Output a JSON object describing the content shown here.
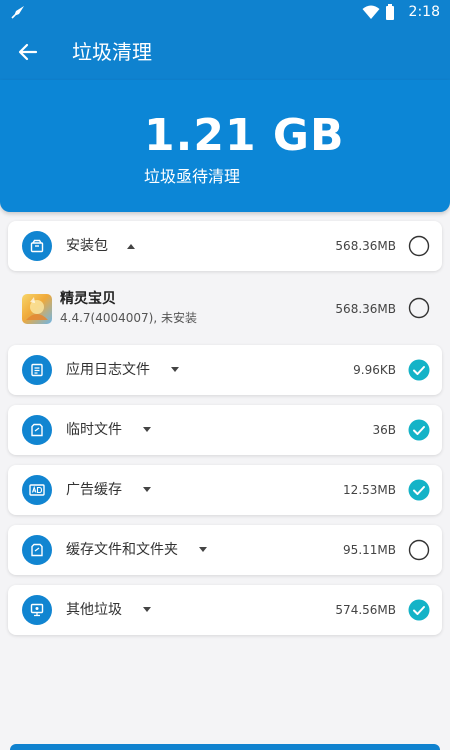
{
  "status_bar": {
    "time": "2:18",
    "icons": [
      "rocket-icon",
      "wifi-icon",
      "battery-icon"
    ]
  },
  "app_bar": {
    "title": "垃圾清理",
    "back_icon": "back-arrow-icon"
  },
  "summary": {
    "size": "1.21 GB",
    "subtitle": "垃圾亟待清理"
  },
  "categories": [
    {
      "label": "安装包",
      "amount": "568.36MB",
      "checked": false,
      "icon": "package-icon",
      "expanded": true
    },
    {
      "label": "应用日志文件",
      "amount": "9.96KB",
      "checked": true,
      "icon": "log-file-icon",
      "expanded": false
    },
    {
      "label": "临时文件",
      "amount": "36B",
      "checked": true,
      "icon": "temp-file-icon",
      "expanded": false
    },
    {
      "label": "广告缓存",
      "amount": "12.53MB",
      "checked": true,
      "icon": "ad-icon",
      "expanded": false
    },
    {
      "label": "缓存文件和文件夹",
      "amount": "95.11MB",
      "checked": false,
      "icon": "cache-icon",
      "expanded": false
    },
    {
      "label": "其他垃圾",
      "amount": "574.56MB",
      "checked": true,
      "icon": "other-junk-icon",
      "expanded": false
    }
  ],
  "apk_item": {
    "name": "精灵宝贝",
    "meta": "4.4.7(4004007), 未安装",
    "amount": "568.36MB",
    "checked": false
  },
  "colors": {
    "primary": "#0f82cf",
    "accent_check": "#14b3c7",
    "background": "#f4f4f6"
  }
}
